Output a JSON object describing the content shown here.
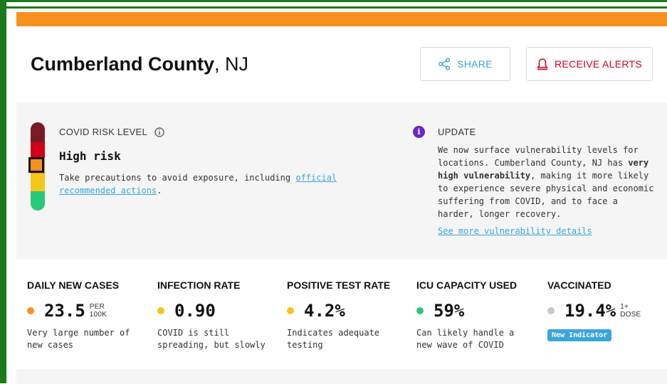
{
  "location": {
    "county": "Cumberland County",
    "state_suffix": ", NJ"
  },
  "actions": {
    "share_label": "SHARE",
    "alerts_label": "RECEIVE ALERTS"
  },
  "risk": {
    "label": "COVID RISK LEVEL",
    "level": "High risk",
    "desc_prefix": "Take precautions to avoid exposure, including ",
    "desc_link": "official recommended actions",
    "desc_suffix": "."
  },
  "update": {
    "title": "UPDATE",
    "body_prefix": "We now surface vulnerability levels for locations. Cumberland County, NJ has ",
    "body_bold": "very high vulnerability",
    "body_suffix": ", making it more likely to experience severe physical and economic suffering from COVID, and to face a harder, longer recovery.",
    "link": "See more vulnerability details"
  },
  "metrics": [
    {
      "title": "DAILY NEW CASES",
      "value": "23.5",
      "unit_line1": "PER",
      "unit_line2": "100K",
      "dot_color": "#f5921e",
      "desc": "Very large number of new cases"
    },
    {
      "title": "INFECTION RATE",
      "value": "0.90",
      "unit_line1": "",
      "unit_line2": "",
      "dot_color": "#f5c518",
      "desc": "COVID is still spreading, but slowly"
    },
    {
      "title": "POSITIVE TEST RATE",
      "value": "4.2%",
      "unit_line1": "",
      "unit_line2": "",
      "dot_color": "#f5c518",
      "desc": "Indicates adequate testing"
    },
    {
      "title": "ICU CAPACITY USED",
      "value": "59%",
      "unit_line1": "",
      "unit_line2": "",
      "dot_color": "#27c97a",
      "desc": "Can likely handle a new wave of COVID"
    },
    {
      "title": "VACCINATED",
      "value": "19.4%",
      "unit_line1": "1+",
      "unit_line2": "DOSE",
      "dot_color": "#c8c8c8",
      "desc": "",
      "badge": "New Indicator"
    }
  ],
  "colors": {
    "accent": "#3aa5dd",
    "alert": "#d0021b",
    "risk_high": "#f5921e",
    "frame": "#1b7a1b"
  },
  "risk_scale": [
    "#7a1a22",
    "#d0021b",
    "#f5921e",
    "#f5c518",
    "#27c97a"
  ]
}
